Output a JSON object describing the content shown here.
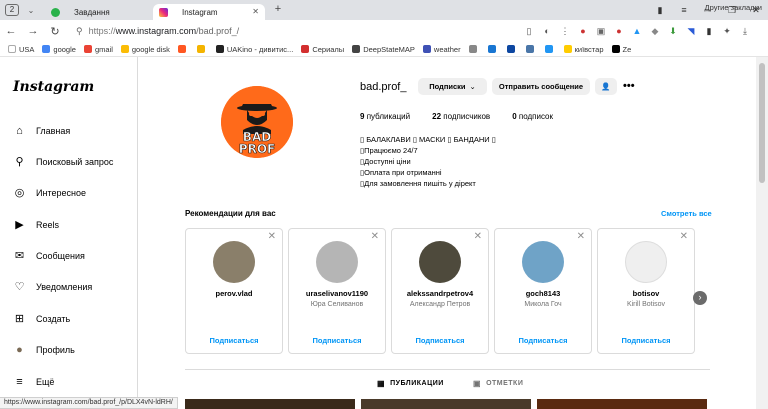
{
  "browser": {
    "tab_counter": "2",
    "tabs": [
      {
        "title": "Завдання",
        "favicon_color": "#2ab24b",
        "active": false
      },
      {
        "title": "Instagram",
        "favicon_color": "#e1306c",
        "active": true
      }
    ],
    "url": {
      "scheme": "https://",
      "host": "www.instagram.com",
      "path": "/bad.prof_/"
    },
    "bookmarks": [
      {
        "label": "USA",
        "color": "#ffffff"
      },
      {
        "label": "google",
        "color": "#4285f4"
      },
      {
        "label": "gmail",
        "color": "#ea4335"
      },
      {
        "label": "google disk",
        "color": "#fbbc05"
      },
      {
        "label": "",
        "color": "#ff5722"
      },
      {
        "label": "",
        "color": "#f4b400"
      },
      {
        "label": "UAKino - дивитис...",
        "color": "#222222"
      },
      {
        "label": "Сериалы",
        "color": "#d32f2f"
      },
      {
        "label": "DeepStateMAP",
        "color": "#444444"
      },
      {
        "label": "weather",
        "color": "#3f51b5"
      },
      {
        "label": "",
        "color": "#888888"
      },
      {
        "label": "",
        "color": "#1976d2"
      },
      {
        "label": "",
        "color": "#0d47a1"
      },
      {
        "label": "",
        "color": "#4a76a8"
      },
      {
        "label": "",
        "color": "#2196f3"
      },
      {
        "label": "київстар",
        "color": "#ffcc00"
      },
      {
        "label": "Ze",
        "color": "#000000"
      }
    ],
    "bookmarks_other": "Другие закладки",
    "status_url": "https://www.instagram.com/bad.prof_/p/DLX4vN-ldRH/"
  },
  "sidebar": {
    "logo": "Instagram",
    "items": [
      {
        "label": "Главная",
        "icon": "home-icon"
      },
      {
        "label": "Поисковый запрос",
        "icon": "search-icon"
      },
      {
        "label": "Интересное",
        "icon": "compass-icon"
      },
      {
        "label": "Reels",
        "icon": "reels-icon"
      },
      {
        "label": "Сообщения",
        "icon": "messenger-icon"
      },
      {
        "label": "Уведомления",
        "icon": "heart-icon"
      },
      {
        "label": "Создать",
        "icon": "create-icon"
      },
      {
        "label": "Профиль",
        "icon": "avatar-icon"
      },
      {
        "label": "Ещё",
        "icon": "menu-icon"
      }
    ]
  },
  "profile": {
    "username": "bad.prof_",
    "following_button": "Подписки",
    "message_button": "Отправить сообщение",
    "avatar_text": [
      "BAD",
      "PROF"
    ],
    "stats": [
      {
        "count": "9",
        "label": "публикаций"
      },
      {
        "count": "22",
        "label": "подписчиков"
      },
      {
        "count": "0",
        "label": "подписок"
      }
    ],
    "bio": [
      "▯ БАЛАКЛАВИ ▯ МАСКИ ▯ БАНДАНИ ▯",
      "▯Працюємо 24/7",
      "▯Доступні ціни",
      "▯Оплата при отриманні",
      "▯Для замовлення пишіть у дірект"
    ]
  },
  "suggestions": {
    "title": "Рекомендации для вас",
    "see_all": "Смотреть все",
    "follow_label": "Подписаться",
    "cards": [
      {
        "username": "perov.vlad",
        "name": "",
        "avatar_color": "#8a7f6a"
      },
      {
        "username": "uraselivanov1190",
        "name": "Юра Селиванов",
        "avatar_color": "#b5b5b5"
      },
      {
        "username": "alekssandrpetrov4",
        "name": "Александр Петров",
        "avatar_color": "#4e4a3c"
      },
      {
        "username": "goch8143",
        "name": "Микола Гоч",
        "avatar_color": "#6fa3c7"
      },
      {
        "username": "botisov",
        "name": "Kirill Botisov",
        "avatar_color": "#efefef"
      }
    ]
  },
  "post_tabs": [
    {
      "label": "ПУБЛИКАЦИИ",
      "icon": "grid-icon",
      "active": true
    },
    {
      "label": "ОТМЕТКИ",
      "icon": "tag-icon",
      "active": false
    }
  ]
}
